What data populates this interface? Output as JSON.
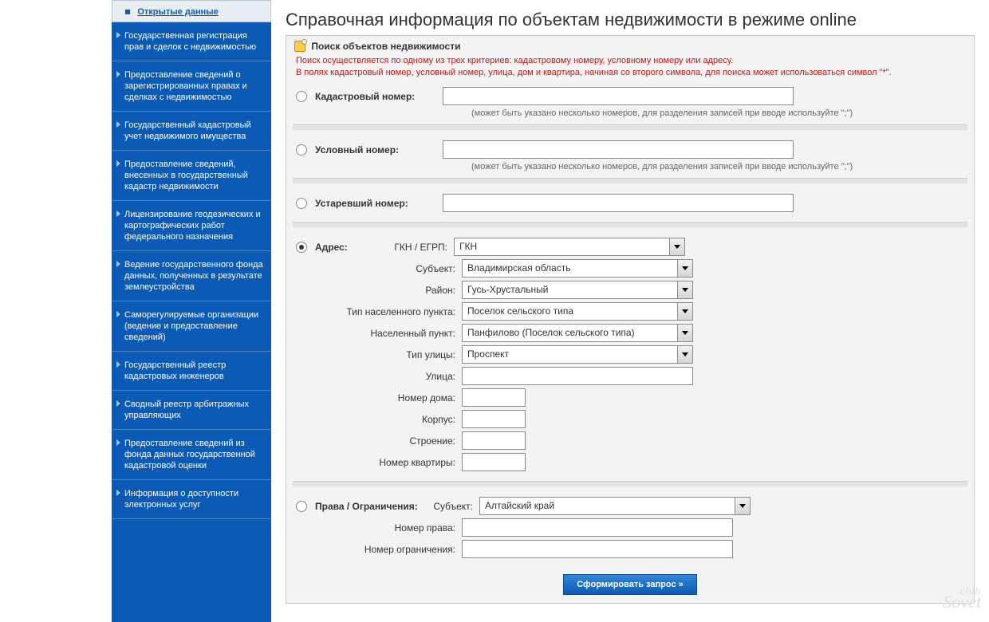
{
  "sidebar": {
    "active_item": "Открытые данные",
    "items": [
      "Государственная регистрация прав и сделок с недвижимостью",
      "Предоставление сведений о зарегистрированных правах и сделках с недвижимостью",
      "Государственный кадастровый учет недвижимого имущества",
      "Предоставление сведений, внесенных в государственный кадастр недвижимости",
      "Лицензирование геодезических и картографических работ федерального назначения",
      "Ведение государственного фонда данных, полученных в результате землеустройства",
      "Саморегулируемые организации (ведение и предоставление сведений)",
      "Государственный реестр кадастровых инженеров",
      "Сводный реестр арбитражных управляющих",
      "Предоставление сведений из фонда данных государственной кадастровой оценки",
      "Информация о доступности электронных услуг"
    ]
  },
  "page_title": "Справочная информация по объектам недвижимости в режиме online",
  "panel": {
    "header": "Поиск объектов недвижимости",
    "warn1": "Поиск осуществляется по одному из трех критериев: кадастровому номеру, условному номеру или адресу.",
    "warn2": "В полях кадастровый номер, условный номер, улица, дом и квартира, начиная со второго символа, для поиска может использоваться символ \"*\"."
  },
  "criteria": {
    "cadastral": {
      "label": "Кадастровый номер:",
      "hint": "(может быть указано несколько номеров, для разделения записей при вводе используйте \";\")"
    },
    "conditional": {
      "label": "Условный номер:",
      "hint": "(может быть указано несколько номеров, для разделения записей при вводе используйте \";\")"
    },
    "obsolete": {
      "label": "Устаревший номер:"
    },
    "address": {
      "label": "Адрес:"
    },
    "rights": {
      "label": "Права / Ограничения:"
    }
  },
  "address": {
    "source_label": "ГКН / ЕГРП:",
    "source_value": "ГКН",
    "subject_label": "Субъект:",
    "subject_value": "Владимирская область",
    "district_label": "Район:",
    "district_value": "Гусь-Хрустальный",
    "settlement_type_label": "Тип населенного пункта:",
    "settlement_type_value": "Поселок сельского типа",
    "settlement_label": "Населенный пункт:",
    "settlement_value": "Панфилово (Поселок сельского типа)",
    "street_type_label": "Тип улицы:",
    "street_type_value": "Проспект",
    "street_label": "Улица:",
    "house_label": "Номер дома:",
    "korpus_label": "Корпус:",
    "building_label": "Строение:",
    "apt_label": "Номер квартиры:"
  },
  "rights": {
    "subject_label": "Субъект:",
    "subject_value": "Алтайский край",
    "number_label": "Номер права:",
    "limit_label": "Номер ограничения:"
  },
  "submit_label": "Сформировать запрос »",
  "watermark": {
    "line1": "club",
    "line2": "Sovet"
  }
}
